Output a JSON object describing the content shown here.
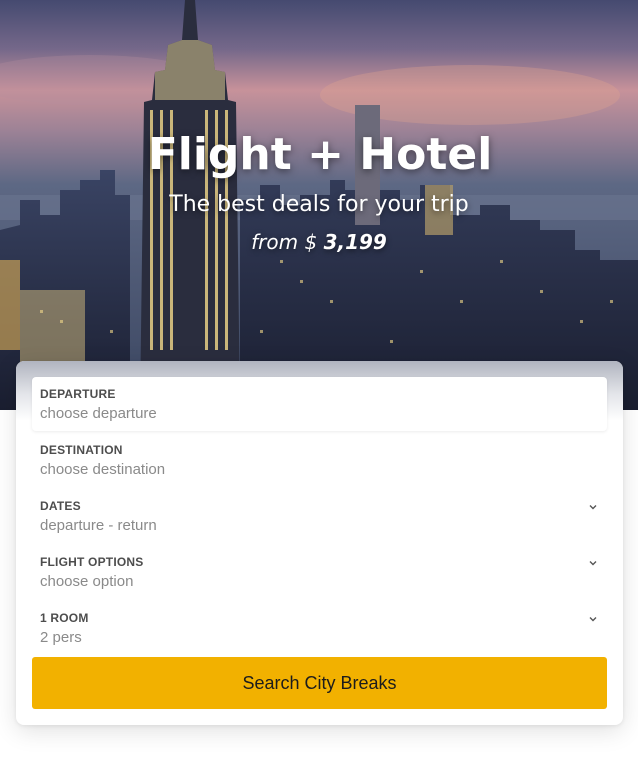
{
  "hero": {
    "title": "Flight + Hotel",
    "subtitle": "The best deals for your trip",
    "price_prefix": "from $",
    "price_amount": "3,199"
  },
  "form": {
    "fields": [
      {
        "label": "DEPARTURE",
        "placeholder": "choose departure",
        "has_dropdown": false
      },
      {
        "label": "DESTINATION",
        "placeholder": "choose destination",
        "has_dropdown": false
      },
      {
        "label": "DATES",
        "placeholder": "departure - return",
        "has_dropdown": true,
        "icon": "chevron-down-icon"
      },
      {
        "label": "FLIGHT OPTIONS",
        "placeholder": "choose option",
        "has_dropdown": true,
        "icon": "chevron-down-icon"
      },
      {
        "label": "1 ROOM",
        "placeholder": "2 pers",
        "has_dropdown": true,
        "icon": "chevron-down-icon"
      }
    ],
    "search_button": "Search City Breaks"
  },
  "colors": {
    "accent": "#f2b100",
    "label_text": "#4d4d4d",
    "placeholder_text": "#8a8a8a"
  }
}
